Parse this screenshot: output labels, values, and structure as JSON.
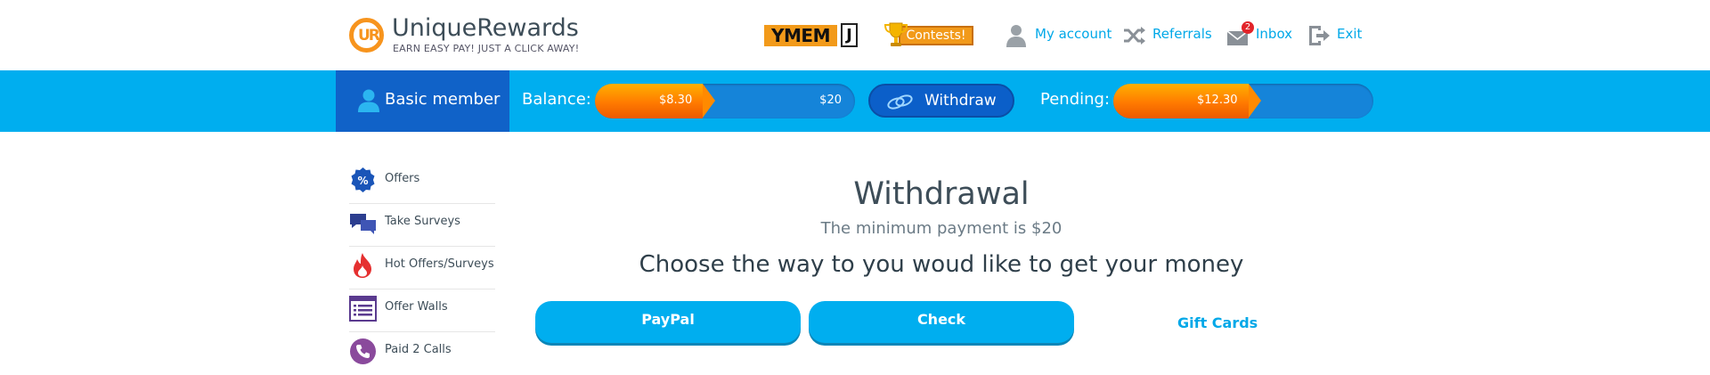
{
  "brand": {
    "logo_mark": "UR",
    "name": "UniqueRewards",
    "tagline": "EARN EASY PAY! JUST A CLICK AWAY!",
    "colors": {
      "orange": "#f7941d",
      "blue": "#00aeef",
      "dark_blue": "#1062c8"
    }
  },
  "header": {
    "ymem_left": "YMEM",
    "ymem_right": "J",
    "contests_label": "Contests!",
    "links": {
      "my_account": "My account",
      "referrals": "Referrals",
      "inbox": "Inbox",
      "inbox_badge": "2",
      "exit": "Exit"
    },
    "icons": [
      "user-icon",
      "shuffle-icon",
      "envelope-icon",
      "exit-door-icon",
      "trophy-icon"
    ]
  },
  "bar": {
    "member_label": "Basic member",
    "balance_label": "Balance:",
    "balance_value": "$8.30",
    "balance_goal": "$20",
    "balance_fraction": 0.415,
    "withdraw_label": "Withdraw",
    "pending_label": "Pending:",
    "pending_value": "$12.30",
    "pending_fraction": 0.52
  },
  "sidebar": {
    "items": [
      {
        "label": "Offers",
        "icon": "percent-badge-icon"
      },
      {
        "label": "Take Surveys",
        "icon": "chat-bubbles-icon"
      },
      {
        "label": "Hot Offers/Surveys",
        "icon": "flame-icon"
      },
      {
        "label": "Offer Walls",
        "icon": "list-window-icon"
      },
      {
        "label": "Paid 2 Calls",
        "icon": "phone-icon"
      }
    ]
  },
  "main": {
    "title": "Withdrawal",
    "subtitle": "The minimum payment is $20",
    "prompt": "Choose the way to you woud like to get your money",
    "options": {
      "paypal": "PayPal",
      "check": "Check",
      "gift_cards": "Gift Cards"
    }
  }
}
